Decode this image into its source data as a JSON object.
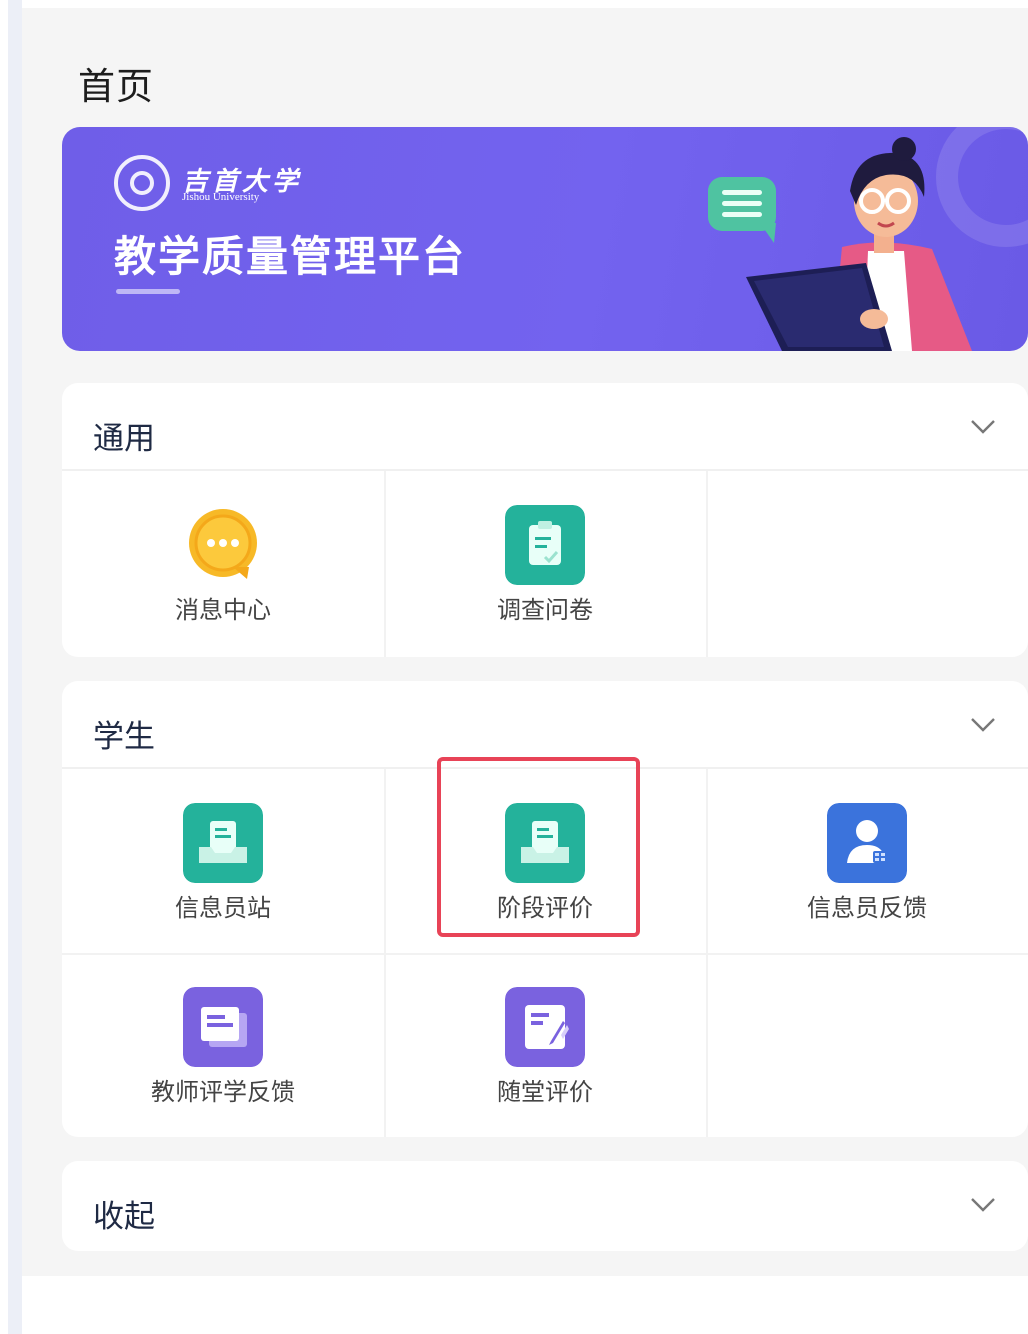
{
  "page": {
    "title": "首页"
  },
  "banner": {
    "university_cn": "吉首大学",
    "university_en": "Jishou University",
    "platform_name": "教学质量管理平台"
  },
  "sections": [
    {
      "title": "通用",
      "items": [
        {
          "label": "消息中心",
          "icon": "chat-bubble-icon"
        },
        {
          "label": "调查问卷",
          "icon": "survey-clipboard-icon"
        }
      ]
    },
    {
      "title": "学生",
      "items": [
        {
          "label": "信息员站",
          "icon": "document-tray-icon"
        },
        {
          "label": "阶段评价",
          "icon": "document-tray-icon"
        },
        {
          "label": "信息员反馈",
          "icon": "user-card-icon"
        },
        {
          "label": "教师评学反馈",
          "icon": "feedback-doc-icon"
        },
        {
          "label": "随堂评价",
          "icon": "edit-doc-icon"
        }
      ]
    },
    {
      "title": "收起",
      "items": []
    }
  ],
  "colors": {
    "banner": "#7363ef",
    "teal_icon": "#24b29b",
    "yellow_icon": "#f7b927",
    "blue_icon": "#3b73dc",
    "purple_icon": "#7a62df",
    "highlight": "#e84357"
  }
}
